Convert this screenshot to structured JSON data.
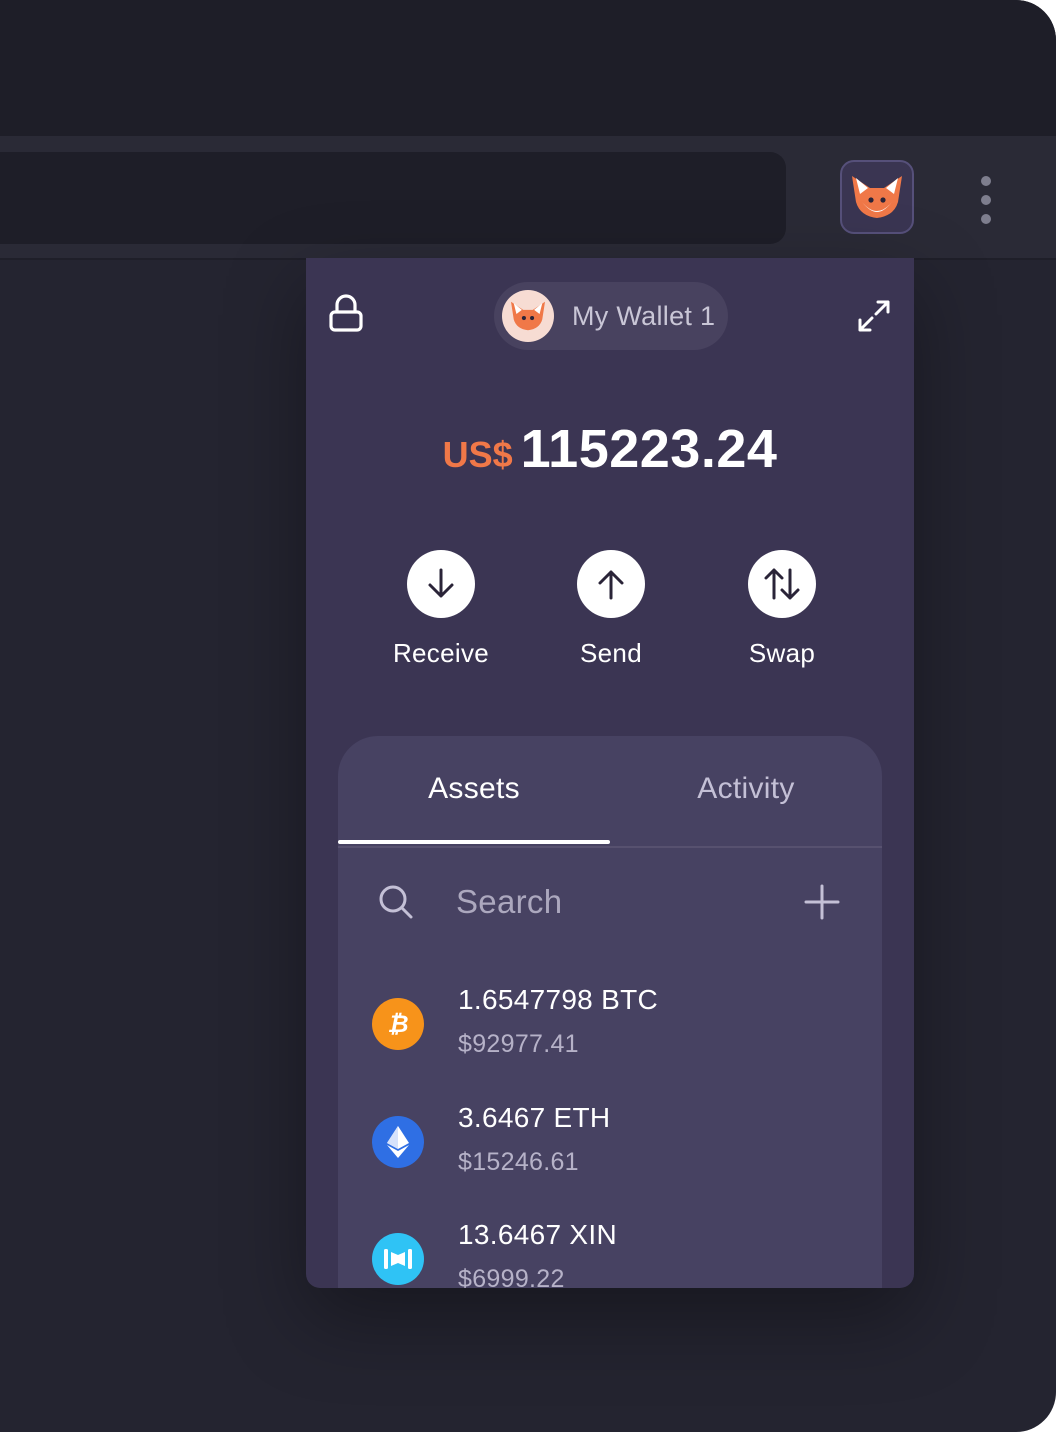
{
  "browser": {
    "extension_icon": "fox-icon",
    "menu_icon": "kebab-menu-icon"
  },
  "wallet": {
    "lock_icon": "lock-icon",
    "name": "My Wallet 1",
    "expand_icon": "expand-icon",
    "balance_currency": "US$",
    "balance_amount": "115223.24"
  },
  "actions": [
    {
      "label": "Receive",
      "icon": "arrow-down-icon"
    },
    {
      "label": "Send",
      "icon": "arrow-up-icon"
    },
    {
      "label": "Swap",
      "icon": "swap-arrows-icon"
    }
  ],
  "tabs": {
    "assets": "Assets",
    "activity": "Activity",
    "active": "Assets"
  },
  "search": {
    "placeholder": "Search",
    "value": ""
  },
  "assets": [
    {
      "amount": "1.6547798 BTC",
      "fiat": "$92977.41",
      "icon": "bitcoin-icon",
      "color": "#f7931a"
    },
    {
      "amount": "3.6467 ETH",
      "fiat": "$15246.61",
      "icon": "ethereum-icon",
      "color": "#2f6fe4"
    },
    {
      "amount": "13.6467 XIN",
      "fiat": "$6999.22",
      "icon": "mixin-icon",
      "color": "#2fc3f5"
    }
  ],
  "colors": {
    "accent": "#f07848",
    "popup_bg": "#3b3553",
    "panel_bg": "#474262"
  }
}
